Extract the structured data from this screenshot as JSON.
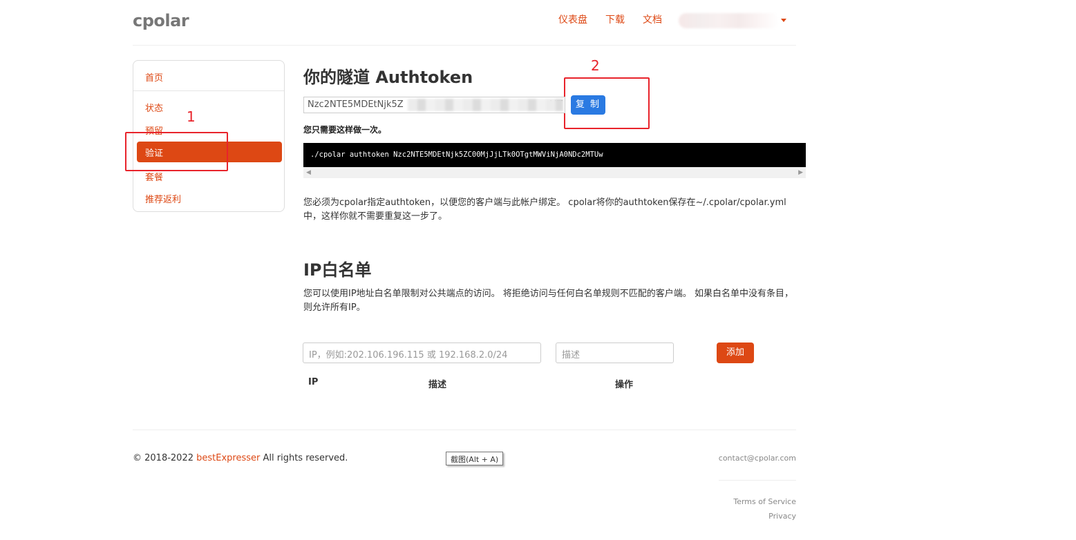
{
  "header": {
    "logo": "cpolar",
    "nav": [
      "仪表盘",
      "下载",
      "文档"
    ]
  },
  "sidebar": {
    "items": [
      {
        "label": "首页"
      },
      {
        "label": "状态"
      },
      {
        "label": "预留"
      },
      {
        "label": "验证"
      },
      {
        "label": "套餐"
      },
      {
        "label": "推荐返利"
      }
    ],
    "active": "验证"
  },
  "annotations": {
    "one": "1",
    "two": "2"
  },
  "authtoken": {
    "title": "你的隧道 Authtoken",
    "token_prefix": "Nzc2NTE5MDEtNjk5Z",
    "token_suffix": "MT",
    "copy_label": "复 制",
    "once_note": "您只需要这样做一次。",
    "command": "./cpolar authtoken Nzc2NTE5MDEtNjk5ZC00MjJjLTk0OTgtMWViNjA0NDc2MTUw",
    "description": "您必须为cpolar指定authtoken，以便您的客户端与此帐户绑定。 cpolar将你的authtoken保存在~/.cpolar/cpolar.yml中，这样你就不需要重复这一步了。"
  },
  "whitelist": {
    "title": "IP白名单",
    "description": "您可以使用IP地址白名单限制对公共端点的访问。 将拒绝访问与任何白名单规则不匹配的客户端。 如果白名单中没有条目，则允许所有IP。",
    "ip_placeholder": "IP，例如:202.106.196.115 或 192.168.2.0/24",
    "desc_placeholder": "描述",
    "add_label": "添加",
    "columns": [
      "IP",
      "描述",
      "操作"
    ]
  },
  "footer": {
    "copyright_prefix": "© 2018-2022 ",
    "brand": "bestExpresser",
    "copyright_suffix": " All rights reserved.",
    "tooltip": "截图(Alt + A)",
    "contact": "contact@cpolar.com",
    "terms": "Terms of Service",
    "privacy": "Privacy"
  },
  "colors": {
    "accent": "#dd4814",
    "copy_button": "#2a7ae2",
    "annotation": "#e8232b"
  }
}
